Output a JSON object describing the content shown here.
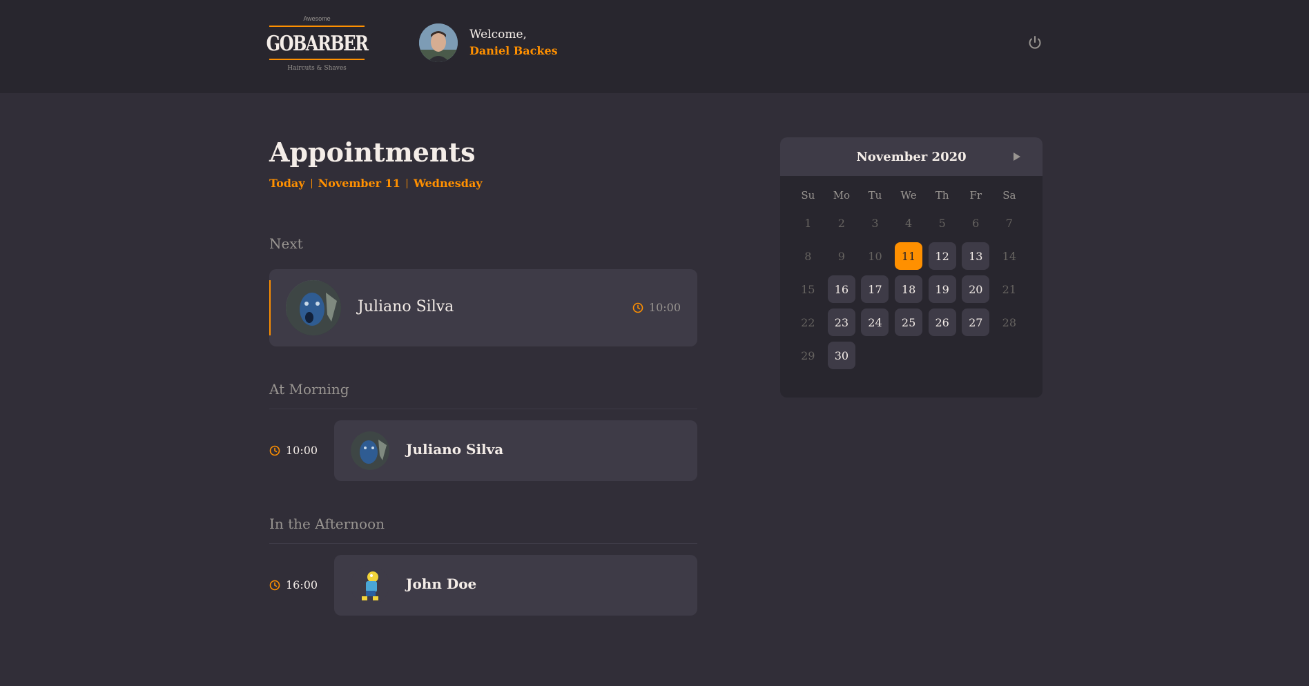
{
  "header": {
    "logo": {
      "top_text": "Awesome",
      "main_text": "GOBARBER",
      "bottom_text": "Haircuts & Shaves"
    },
    "welcome_text": "Welcome,",
    "user_name": "Daniel Backes",
    "power_icon": "power-icon"
  },
  "page": {
    "title": "Appointments",
    "subtitle": {
      "today": "Today",
      "date": "November 11",
      "weekday": "Wednesday"
    }
  },
  "next": {
    "label": "Next",
    "name": "Juliano Silva",
    "time": "10:00",
    "icon": "clock-icon"
  },
  "morning": {
    "label": "At Morning",
    "appointments": [
      {
        "time": "10:00",
        "name": "Juliano Silva"
      }
    ]
  },
  "afternoon": {
    "label": "In the Afternoon",
    "appointments": [
      {
        "time": "16:00",
        "name": "John Doe"
      }
    ]
  },
  "calendar": {
    "title": "November 2020",
    "next_icon": "next-month-arrow-icon",
    "weekdays": [
      "Su",
      "Mo",
      "Tu",
      "We",
      "Th",
      "Fr",
      "Sa"
    ],
    "days": [
      "1",
      "2",
      "3",
      "4",
      "5",
      "6",
      "7",
      "8",
      "9",
      "10",
      "11",
      "12",
      "13",
      "14",
      "15",
      "16",
      "17",
      "18",
      "19",
      "20",
      "21",
      "22",
      "23",
      "24",
      "25",
      "26",
      "27",
      "28",
      "29",
      "30"
    ],
    "available_days": [
      11,
      12,
      13,
      16,
      17,
      18,
      19,
      20,
      23,
      24,
      25,
      26,
      27,
      30
    ],
    "selected_day": 11
  },
  "colors": {
    "accent": "#ff9000",
    "background": "#312e38",
    "header": "#28262e",
    "card": "#3e3b47",
    "muted": "#999591"
  }
}
